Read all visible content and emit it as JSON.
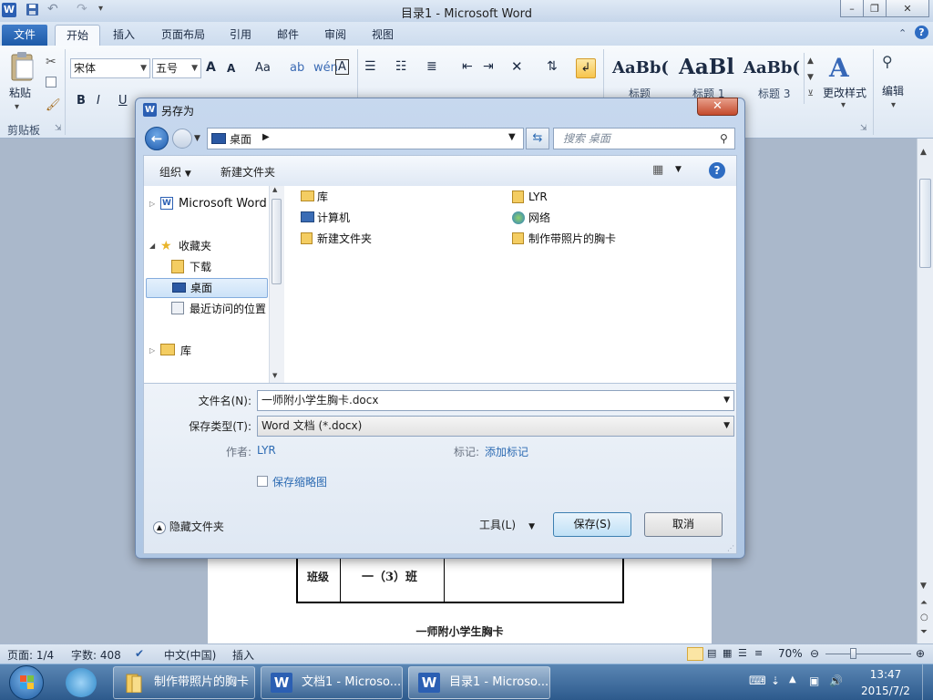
{
  "window": {
    "title": "目录1 - Microsoft Word"
  },
  "ribbon": {
    "tabs": [
      "文件",
      "开始",
      "插入",
      "页面布局",
      "引用",
      "邮件",
      "审阅",
      "视图"
    ],
    "active_tab": "开始",
    "clipboard": {
      "paste_label": "粘贴",
      "group_label": "剪贴板"
    },
    "font": {
      "name": "宋体",
      "size": "五号",
      "grow": "A",
      "shrink": "A",
      "case": "Aa",
      "clear": "A"
    },
    "format_buttons": [
      "B",
      "I",
      "U"
    ],
    "styles": [
      {
        "sample": "AaBb(",
        "name": "标题"
      },
      {
        "sample": "AaBl",
        "name": "标题 1"
      },
      {
        "sample": "AaBb(",
        "name": "标题 3"
      }
    ],
    "change_styles": "更改样式",
    "editing": "编辑"
  },
  "document": {
    "table_row": {
      "label": "班级",
      "value": "一（3）班"
    },
    "heading": "一师附小学生胸卡"
  },
  "status": {
    "page": "页面: 1/4",
    "words": "字数: 408",
    "language": "中文(中国)",
    "mode": "插入",
    "zoom": "70%",
    "zoom_level_percent": 70
  },
  "taskbar": {
    "items": [
      {
        "label": "制作带照片的胸卡"
      },
      {
        "label": "文档1 - Microso..."
      },
      {
        "label": "目录1 - Microso..."
      }
    ],
    "time": "13:47",
    "date": "2015/7/2"
  },
  "dialog": {
    "title": "另存为",
    "address": "桌面",
    "search_placeholder": "搜索 桌面",
    "toolbar": {
      "organize": "组织",
      "new_folder": "新建文件夹"
    },
    "nav": {
      "word": "Microsoft Word",
      "favorites": "收藏夹",
      "downloads": "下载",
      "desktop": "桌面",
      "recent": "最近访问的位置",
      "library": "库"
    },
    "files": [
      {
        "name": "库",
        "icon": "library-folder-icon"
      },
      {
        "name": "LYR",
        "icon": "user-folder-icon"
      },
      {
        "name": "计算机",
        "icon": "computer-icon"
      },
      {
        "name": "网络",
        "icon": "network-icon"
      },
      {
        "name": "新建文件夹",
        "icon": "folder-icon"
      },
      {
        "name": "制作带照片的胸卡",
        "icon": "folder-icon"
      }
    ],
    "filename_label": "文件名(N):",
    "filename_value": "一师附小学生胸卡.docx",
    "filetype_label": "保存类型(T):",
    "filetype_value": "Word 文档 (*.docx)",
    "author_label": "作者:",
    "author_value": "LYR",
    "tags_label": "标记:",
    "tags_value": "添加标记",
    "thumbnail_label": "保存缩略图",
    "hide_folders": "隐藏文件夹",
    "tools": "工具(L)",
    "save": "保存(S)",
    "cancel": "取消"
  }
}
